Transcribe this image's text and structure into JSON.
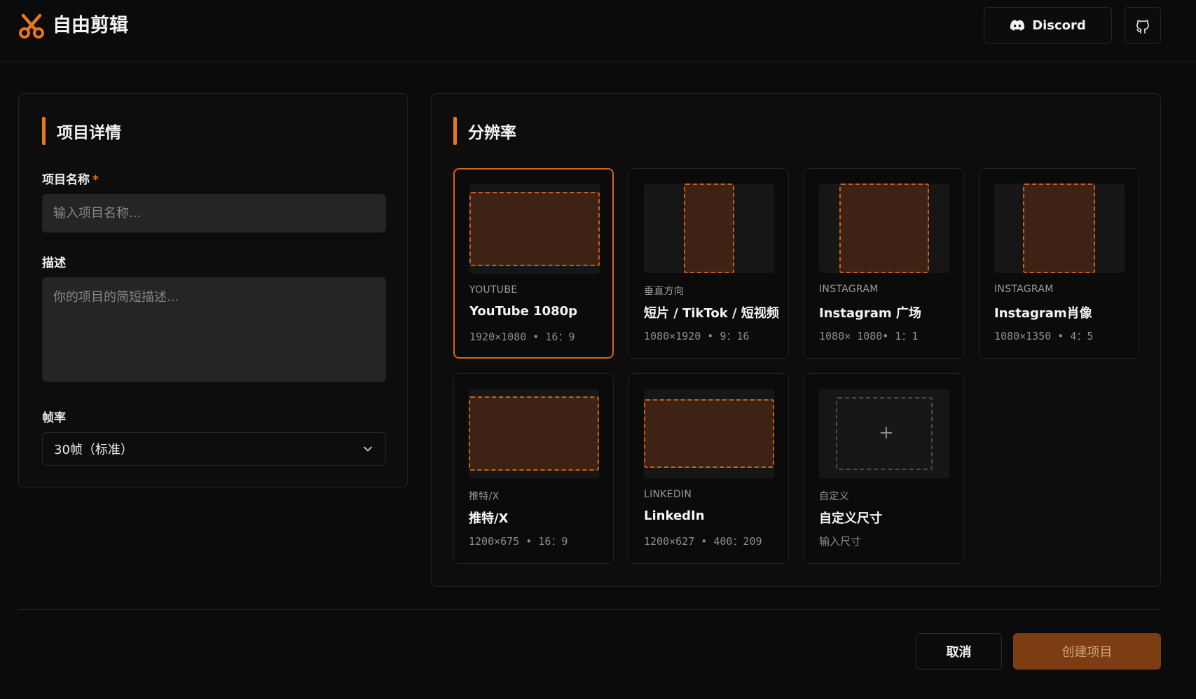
{
  "app": {
    "title": "自由剪辑"
  },
  "header": {
    "discord_label": "Discord",
    "brand_color": "#e8781c"
  },
  "details": {
    "section_title": "项目详情",
    "name_label": "项目名称",
    "name_required_mark": "*",
    "name_placeholder": "输入项目名称...",
    "name_value": "",
    "description_label": "描述",
    "description_placeholder": "你的项目的简短描述...",
    "description_value": "",
    "framerate_label": "帧率",
    "framerate_value": "30帧（标准）"
  },
  "resolution": {
    "section_title": "分辨率",
    "selected_index": 0,
    "presets": [
      {
        "category": "YOUTUBE",
        "name": "YouTube 1080p",
        "dims": "1920×1080 • 16：9",
        "aspect": "16:9",
        "selected": true
      },
      {
        "category": "垂直方向",
        "name": "短片 / TikTok / 短视频",
        "dims": "1080×1920 • 9：16",
        "aspect": "9:16",
        "selected": false
      },
      {
        "category": "INSTAGRAM",
        "name": "Instagram 广场",
        "dims": "1080× 1080• 1：1",
        "aspect": "1:1",
        "selected": false
      },
      {
        "category": "INSTAGRAM",
        "name": "Instagram肖像",
        "dims": "1080×1350 • 4：5",
        "aspect": "4:5",
        "selected": false
      },
      {
        "category": "推特/X",
        "name": "推特/X",
        "dims": "1200×675 • 16：9",
        "aspect": "16:9",
        "selected": false
      },
      {
        "category": "LINKEDIN",
        "name": "LinkedIn",
        "dims": "1200×627 • 400：209",
        "aspect": "400:209",
        "selected": false
      },
      {
        "category": "自定义",
        "name": "自定义尺寸",
        "dims": "输入尺寸",
        "aspect": "custom",
        "selected": false,
        "icon": "plus-icon"
      }
    ]
  },
  "footer": {
    "cancel_label": "取消",
    "create_label": "创建项目"
  }
}
